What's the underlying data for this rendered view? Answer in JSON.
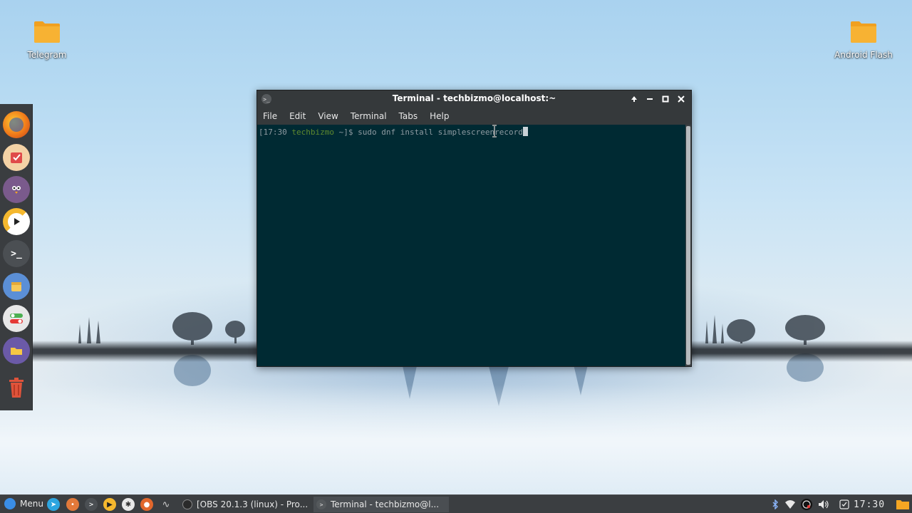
{
  "desktop": {
    "icons": [
      {
        "label": "Telegram"
      },
      {
        "label": "Android Flash"
      }
    ]
  },
  "colors": {
    "folder": "#f5a623",
    "terminal_bg": "#002a33",
    "prompt_user": "#5f8a2e",
    "titlebar": "#35393b"
  },
  "dock": {
    "items": [
      {
        "icon": "firefox-icon"
      },
      {
        "icon": "task-checklist-icon"
      },
      {
        "icon": "pidgin-icon"
      },
      {
        "icon": "media-player-icon"
      },
      {
        "icon": "terminal-icon"
      },
      {
        "icon": "package-icon"
      },
      {
        "icon": "settings-toggle-icon"
      },
      {
        "icon": "file-manager-icon"
      },
      {
        "icon": "trash-icon"
      }
    ]
  },
  "window": {
    "title": "Terminal - techbizmo@localhost:~",
    "menu": [
      "File",
      "Edit",
      "View",
      "Terminal",
      "Tabs",
      "Help"
    ],
    "terminal": {
      "prompt_open": "[17:30 ",
      "user": "techbizmo",
      "prompt_close": " ~]$ ",
      "command": "sudo dnf install simplescreenrecord"
    }
  },
  "taskbar": {
    "menu_label": "Menu",
    "tasks": [
      {
        "label": "[OBS 20.1.3 (linux) - Pro..."
      },
      {
        "label": "Terminal - techbizmo@l..."
      }
    ],
    "clock": "17:30"
  }
}
